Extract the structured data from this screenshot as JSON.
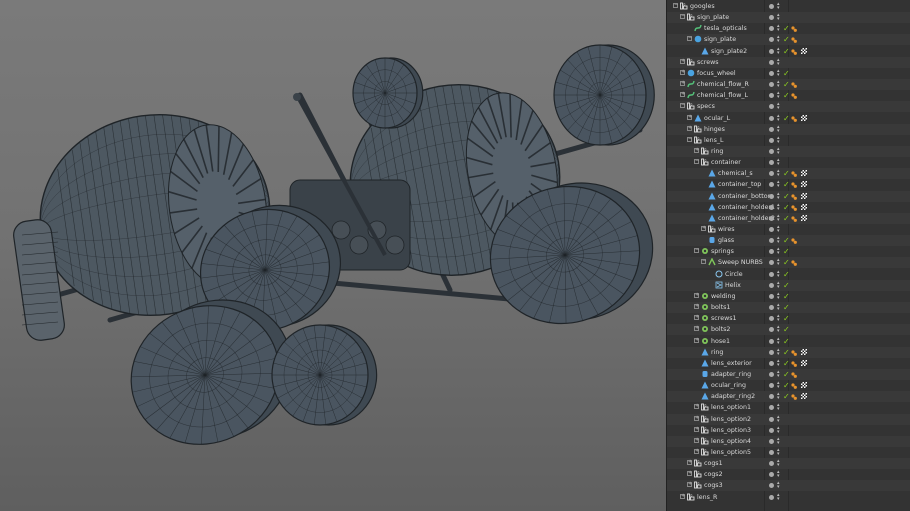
{
  "objects_panel": {
    "items": [
      {
        "label": "googles",
        "depth": 0,
        "icon": "null-icon",
        "expand": "minus",
        "check": false,
        "tag": "none"
      },
      {
        "label": "sign_plate",
        "depth": 1,
        "icon": "null-icon",
        "expand": "minus",
        "check": false,
        "tag": "none"
      },
      {
        "label": "tesla_opticals",
        "depth": 2,
        "icon": "spline-icon",
        "expand": "none",
        "check": true,
        "tag": "phong"
      },
      {
        "label": "sign_plate",
        "depth": 2,
        "icon": "sphere-icon",
        "expand": "minus",
        "check": true,
        "tag": "phong"
      },
      {
        "label": "sign_plate2",
        "depth": 3,
        "icon": "polygon-icon",
        "expand": "none",
        "check": true,
        "tag": "phong-check"
      },
      {
        "label": "screws",
        "depth": 1,
        "icon": "null-icon",
        "expand": "plus",
        "check": false,
        "tag": "none"
      },
      {
        "label": "focus_wheel",
        "depth": 1,
        "icon": "sphere-icon",
        "expand": "plus",
        "check": true,
        "tag": "none"
      },
      {
        "label": "chemical_flow_R",
        "depth": 1,
        "icon": "spline-icon",
        "expand": "plus",
        "check": true,
        "tag": "phong"
      },
      {
        "label": "chemical_flow_L",
        "depth": 1,
        "icon": "spline-icon",
        "expand": "plus",
        "check": true,
        "tag": "phong"
      },
      {
        "label": "specs",
        "depth": 1,
        "icon": "null-icon",
        "expand": "minus",
        "check": false,
        "tag": "none"
      },
      {
        "label": "ocular_L",
        "depth": 2,
        "icon": "polygon-icon",
        "expand": "plus",
        "check": true,
        "tag": "phong-check"
      },
      {
        "label": "hinges",
        "depth": 2,
        "icon": "null-icon",
        "expand": "plus",
        "check": false,
        "tag": "none"
      },
      {
        "label": "lens_L",
        "depth": 2,
        "icon": "null-icon",
        "expand": "minus",
        "check": false,
        "tag": "none"
      },
      {
        "label": "ring",
        "depth": 3,
        "icon": "null-icon",
        "expand": "plus",
        "check": false,
        "tag": "none"
      },
      {
        "label": "container",
        "depth": 3,
        "icon": "null-icon",
        "expand": "minus",
        "check": false,
        "tag": "none"
      },
      {
        "label": "chemical_s",
        "depth": 4,
        "icon": "polygon-icon",
        "expand": "none",
        "check": true,
        "tag": "phong-check"
      },
      {
        "label": "container_top",
        "depth": 4,
        "icon": "polygon-icon",
        "expand": "none",
        "check": true,
        "tag": "phong-check"
      },
      {
        "label": "container_bottom",
        "depth": 4,
        "icon": "polygon-icon",
        "expand": "none",
        "check": true,
        "tag": "phong-check"
      },
      {
        "label": "container_holder1",
        "depth": 4,
        "icon": "polygon-icon",
        "expand": "none",
        "check": true,
        "tag": "phong-check"
      },
      {
        "label": "container_holder2",
        "depth": 4,
        "icon": "polygon-icon",
        "expand": "none",
        "check": true,
        "tag": "phong-check"
      },
      {
        "label": "wires",
        "depth": 4,
        "icon": "null-icon",
        "expand": "plus",
        "check": false,
        "tag": "none"
      },
      {
        "label": "glass",
        "depth": 4,
        "icon": "cylinder-icon",
        "expand": "none",
        "check": true,
        "tag": "phong"
      },
      {
        "label": "springs",
        "depth": 3,
        "icon": "cloner-icon",
        "expand": "minus",
        "check": true,
        "tag": "none"
      },
      {
        "label": "Sweep NURBS",
        "depth": 4,
        "icon": "sweep-icon",
        "expand": "minus",
        "check": true,
        "tag": "phong"
      },
      {
        "label": "Circle",
        "depth": 5,
        "icon": "circle-icon",
        "expand": "none",
        "check": true,
        "tag": "none"
      },
      {
        "label": "Helix",
        "depth": 5,
        "icon": "helix-icon",
        "expand": "none",
        "check": true,
        "tag": "none"
      },
      {
        "label": "welding",
        "depth": 3,
        "icon": "cloner-icon",
        "expand": "plus",
        "check": true,
        "tag": "none"
      },
      {
        "label": "bolts1",
        "depth": 3,
        "icon": "cloner-icon",
        "expand": "plus",
        "check": true,
        "tag": "none"
      },
      {
        "label": "screws1",
        "depth": 3,
        "icon": "cloner-icon",
        "expand": "plus",
        "check": true,
        "tag": "none"
      },
      {
        "label": "bolts2",
        "depth": 3,
        "icon": "cloner-icon",
        "expand": "plus",
        "check": true,
        "tag": "none"
      },
      {
        "label": "hose1",
        "depth": 3,
        "icon": "cloner-icon",
        "expand": "plus",
        "check": true,
        "tag": "none"
      },
      {
        "label": "ring",
        "depth": 3,
        "icon": "polygon-icon",
        "expand": "none",
        "check": true,
        "tag": "phong-check"
      },
      {
        "label": "lens_exterior",
        "depth": 3,
        "icon": "polygon-icon",
        "expand": "none",
        "check": true,
        "tag": "phong-check"
      },
      {
        "label": "adapter_ring",
        "depth": 3,
        "icon": "cylinder-icon",
        "expand": "none",
        "check": true,
        "tag": "phong"
      },
      {
        "label": "ocular_ring",
        "depth": 3,
        "icon": "polygon-icon",
        "expand": "none",
        "check": true,
        "tag": "phong-check"
      },
      {
        "label": "adapter_ring2",
        "depth": 3,
        "icon": "polygon-icon",
        "expand": "none",
        "check": true,
        "tag": "phong-check"
      },
      {
        "label": "lens_option1",
        "depth": 3,
        "icon": "null-icon",
        "expand": "plus",
        "check": false,
        "tag": "none"
      },
      {
        "label": "lens_option2",
        "depth": 3,
        "icon": "null-icon",
        "expand": "plus",
        "check": false,
        "tag": "none"
      },
      {
        "label": "lens_option3",
        "depth": 3,
        "icon": "null-icon",
        "expand": "plus",
        "check": false,
        "tag": "none"
      },
      {
        "label": "lens_option4",
        "depth": 3,
        "icon": "null-icon",
        "expand": "plus",
        "check": false,
        "tag": "none"
      },
      {
        "label": "lens_option5",
        "depth": 3,
        "icon": "null-icon",
        "expand": "plus",
        "check": false,
        "tag": "none"
      },
      {
        "label": "cogs1",
        "depth": 2,
        "icon": "null-icon",
        "expand": "plus",
        "check": false,
        "tag": "none"
      },
      {
        "label": "cogs2",
        "depth": 2,
        "icon": "null-icon",
        "expand": "plus",
        "check": false,
        "tag": "none"
      },
      {
        "label": "cogs3",
        "depth": 2,
        "icon": "null-icon",
        "expand": "plus",
        "check": false,
        "tag": "none"
      },
      {
        "label": "lens_R",
        "depth": 1,
        "icon": "null-icon",
        "expand": "plus",
        "check": false,
        "tag": "none"
      }
    ]
  },
  "colors": {
    "check": "#8fd11f",
    "phong_tag": "#e8932c",
    "mesh": "#4a5560",
    "wire": "#1f2428"
  }
}
